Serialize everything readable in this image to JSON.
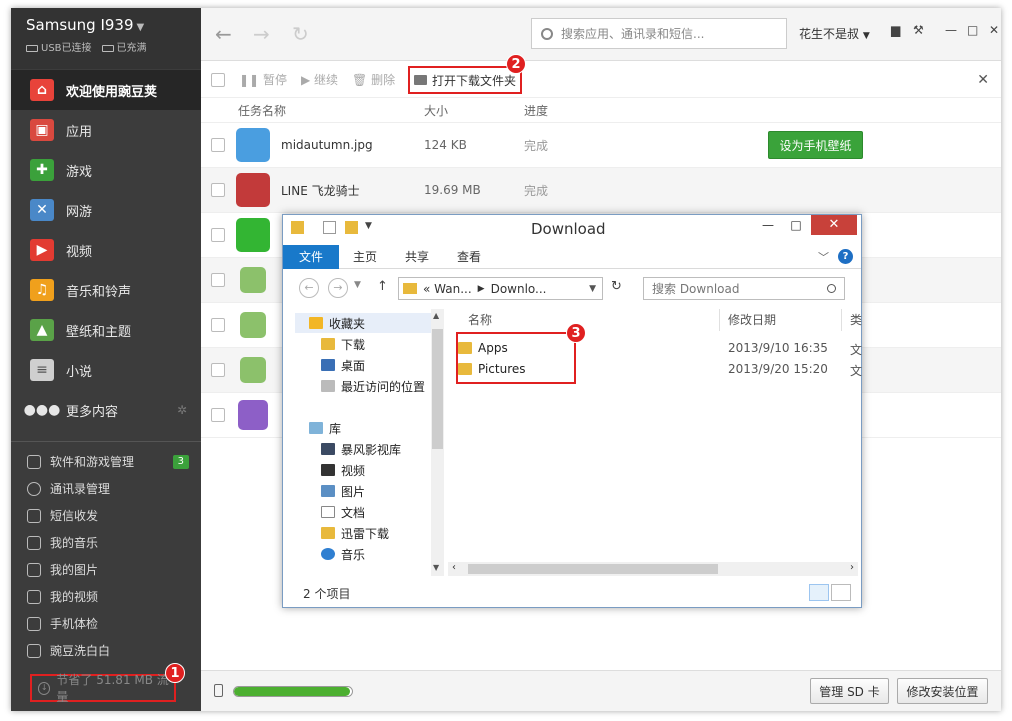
{
  "device": {
    "name": "Samsung I939",
    "usb_status": "USB已连接",
    "battery_status": "已充满"
  },
  "sidebar": {
    "nav": [
      {
        "label": "欢迎使用豌豆荚",
        "color": "#e8433a"
      },
      {
        "label": "应用",
        "color": "#d9493f"
      },
      {
        "label": "游戏",
        "color": "#3ba13b"
      },
      {
        "label": "网游",
        "color": "#4a88c8"
      },
      {
        "label": "视频",
        "color": "#e23b32"
      },
      {
        "label": "音乐和铃声",
        "color": "#f0a01c"
      },
      {
        "label": "壁纸和主题",
        "color": "#5aa248"
      },
      {
        "label": "小说",
        "color": "#cfcfcf"
      },
      {
        "label": "更多内容",
        "color": "#e6e6e6"
      }
    ],
    "sub": [
      {
        "label": "软件和游戏管理",
        "badge": "3"
      },
      {
        "label": "通讯录管理"
      },
      {
        "label": "短信收发"
      },
      {
        "label": "我的音乐"
      },
      {
        "label": "我的图片"
      },
      {
        "label": "我的视频"
      },
      {
        "label": "手机体检"
      },
      {
        "label": "豌豆洗白白"
      }
    ],
    "saved": "节省了 51.81 MB 流量"
  },
  "header": {
    "search_placeholder": "搜索应用、通讯录和短信...",
    "user": "花生不是叔"
  },
  "toolbar": {
    "pause": "暂停",
    "resume": "继续",
    "delete": "删除",
    "open_folder": "打开下载文件夹"
  },
  "table": {
    "headers": {
      "name": "任务名称",
      "size": "大小",
      "progress": "进度"
    },
    "rows": [
      {
        "name": "midautumn.jpg",
        "size": "124 KB",
        "progress": "完成",
        "action": "设为手机壁纸"
      },
      {
        "name": "LINE 飞龙骑士",
        "size": "19.69 MB",
        "progress": "完成"
      }
    ]
  },
  "status": {
    "download_fill": 0.98,
    "manage_sd": "管理 SD 卡",
    "install_location": "修改安装位置"
  },
  "markers": {
    "m1": "1",
    "m2": "2",
    "m3": "3"
  },
  "explorer": {
    "title": "Download",
    "tabs": [
      "文件",
      "主页",
      "共享",
      "查看"
    ],
    "address": {
      "part1": "« Wan...",
      "part2": "Downlo..."
    },
    "search_placeholder": "搜索 Download",
    "tree": [
      "收藏夹",
      "下载",
      "桌面",
      "最近访问的位置",
      "库",
      "暴风影视库",
      "视频",
      "图片",
      "文档",
      "迅雷下载",
      "音乐"
    ],
    "columns": {
      "name": "名称",
      "date": "修改日期",
      "extra": "类"
    },
    "files": [
      {
        "name": "Apps",
        "date": "2013/9/10 16:35",
        "extra": "文"
      },
      {
        "name": "Pictures",
        "date": "2013/9/20 15:20",
        "extra": "文"
      }
    ],
    "item_count": "2 个项目"
  }
}
